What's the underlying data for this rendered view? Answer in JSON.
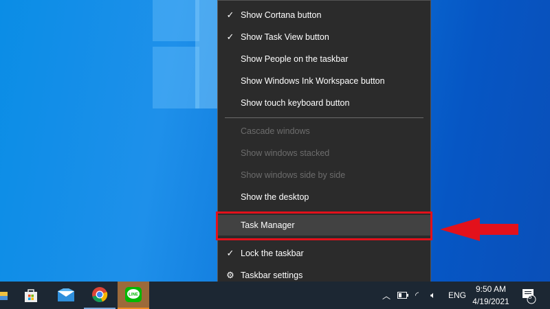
{
  "menu": {
    "items": [
      {
        "label": "Show Cortana button",
        "checked": true,
        "enabled": true
      },
      {
        "label": "Show Task View button",
        "checked": true,
        "enabled": true
      },
      {
        "label": "Show People on the taskbar",
        "enabled": true
      },
      {
        "label": "Show Windows Ink Workspace button",
        "enabled": true
      },
      {
        "label": "Show touch keyboard button",
        "enabled": true
      },
      {
        "label": "Cascade windows",
        "enabled": false
      },
      {
        "label": "Show windows stacked",
        "enabled": false
      },
      {
        "label": "Show windows side by side",
        "enabled": false
      },
      {
        "label": "Show the desktop",
        "enabled": true
      },
      {
        "label": "Task Manager",
        "enabled": true,
        "highlighted": true
      },
      {
        "label": "Lock the taskbar",
        "checked": true,
        "enabled": true
      },
      {
        "label": "Taskbar settings",
        "icon": "gear-icon",
        "enabled": true
      }
    ]
  },
  "annotation": {
    "highlight_color": "#e3111b"
  },
  "taskbar": {
    "apps": [
      "file-explorer",
      "microsoft-store",
      "mail",
      "chrome",
      "line"
    ],
    "line_label": "LINE"
  },
  "tray": {
    "language": "ENG",
    "time": "9:50 AM",
    "date": "4/19/2021",
    "notifications": "8"
  }
}
